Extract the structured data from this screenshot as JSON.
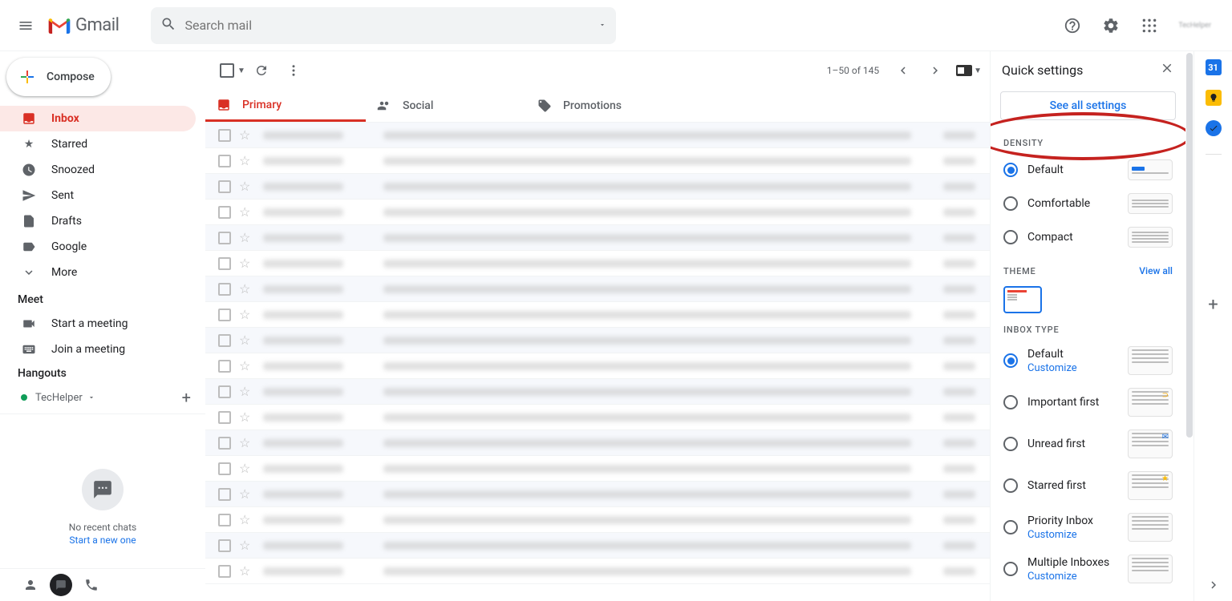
{
  "header": {
    "logo_text": "Gmail",
    "search_placeholder": "Search mail",
    "profile_name": "TecHelper"
  },
  "sidebar": {
    "compose": "Compose",
    "nav": [
      "Inbox",
      "Starred",
      "Snoozed",
      "Sent",
      "Drafts",
      "Google",
      "More"
    ],
    "meet_header": "Meet",
    "meet_items": [
      "Start a meeting",
      "Join a meeting"
    ],
    "hangouts_header": "Hangouts",
    "hangouts_user": "TecHelper",
    "no_chats": "No recent chats",
    "start_new": "Start a new one"
  },
  "toolbar": {
    "page_info": "1–50 of 145"
  },
  "tabs": [
    "Primary",
    "Social",
    "Promotions"
  ],
  "quick_settings": {
    "title": "Quick settings",
    "see_all": "See all settings",
    "density_title": "DENSITY",
    "density_options": [
      "Default",
      "Comfortable",
      "Compact"
    ],
    "theme_title": "THEME",
    "theme_view_all": "View all",
    "inbox_type_title": "INBOX TYPE",
    "inbox_options": [
      {
        "label": "Default",
        "customize": "Customize",
        "selected": true
      },
      {
        "label": "Important first",
        "customize": "",
        "selected": false
      },
      {
        "label": "Unread first",
        "customize": "",
        "selected": false
      },
      {
        "label": "Starred first",
        "customize": "",
        "selected": false
      },
      {
        "label": "Priority Inbox",
        "customize": "Customize",
        "selected": false
      },
      {
        "label": "Multiple Inboxes",
        "customize": "Customize",
        "selected": false
      }
    ]
  }
}
